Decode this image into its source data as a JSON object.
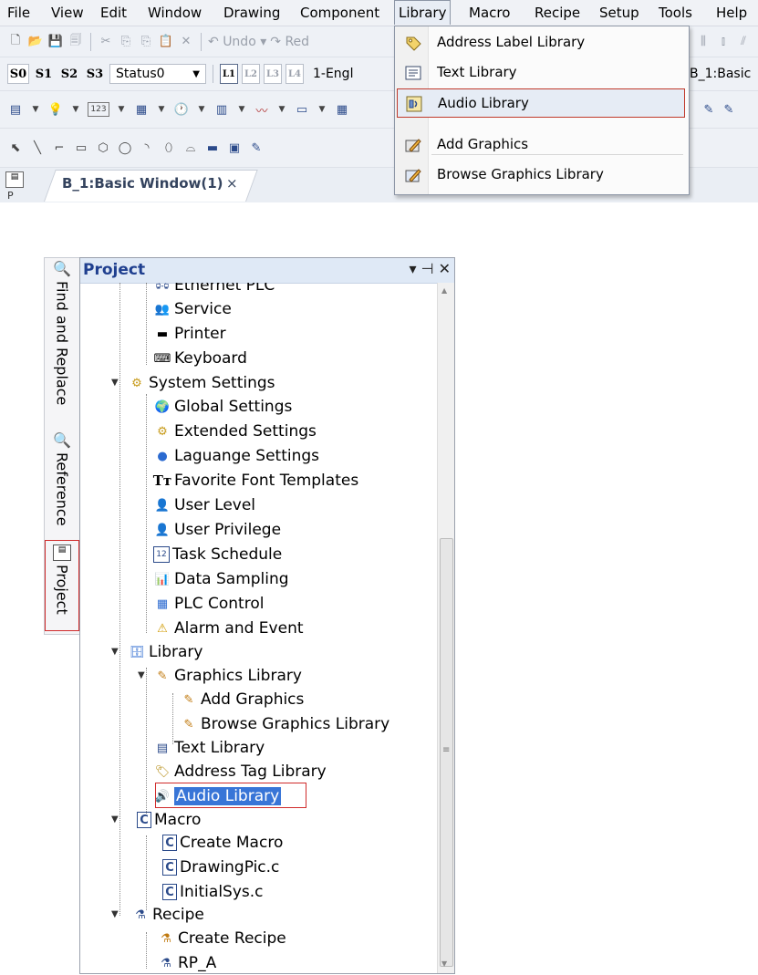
{
  "menubar": {
    "items": [
      "File",
      "View",
      "Edit",
      "Window",
      "Drawing",
      "Component",
      "Library",
      "Macro",
      "Recipe",
      "Setup",
      "Tools",
      "Help"
    ],
    "active": "Library"
  },
  "toolbar1": {
    "undo_label": "Undo",
    "redo_label": "Red"
  },
  "toolbar2": {
    "status_buttons": [
      "S0",
      "S1",
      "S2",
      "S3"
    ],
    "status_value": "Status0",
    "layer_buttons": [
      "L1",
      "L2",
      "L3",
      "L4"
    ],
    "language_value": "1-Engl",
    "window_value": "B_1:Basic"
  },
  "document_tab": {
    "label": "B_1:Basic Window(1)",
    "close": "×"
  },
  "library_menu": {
    "items": [
      {
        "label": "Address Label Library",
        "icon": "tag-icon"
      },
      {
        "label": "Text Library",
        "icon": "text-icon"
      },
      {
        "label": "Audio Library",
        "icon": "audio-icon",
        "highlighted": true
      },
      {
        "label": "Add Graphics",
        "icon": "add-graphics-icon"
      },
      {
        "label": "Browse Graphics Library",
        "icon": "browse-graphics-icon"
      }
    ]
  },
  "side_tabs": [
    "Find and Replace",
    "Reference",
    "Project"
  ],
  "panel": {
    "title": "Project",
    "controls": "▾ ⊣ ✕"
  },
  "tree": {
    "items": [
      {
        "label": "Ethernet PLC",
        "icon": "ethernet-plc-icon"
      },
      {
        "label": "Service",
        "icon": "service-icon"
      },
      {
        "label": "Printer",
        "icon": "printer-icon"
      },
      {
        "label": "Keyboard",
        "icon": "keyboard-icon"
      },
      {
        "label": "System Settings",
        "icon": "system-settings-icon"
      },
      {
        "label": "Global Settings",
        "icon": "globe-icon"
      },
      {
        "label": "Extended Settings",
        "icon": "extended-settings-icon"
      },
      {
        "label": "Laguange Settings",
        "icon": "language-icon"
      },
      {
        "label": "Favorite Font Templates",
        "icon": "font-icon"
      },
      {
        "label": "User Level",
        "icon": "user-level-icon"
      },
      {
        "label": "User Privilege",
        "icon": "user-privilege-icon"
      },
      {
        "label": "Task Schedule",
        "icon": "calendar-icon"
      },
      {
        "label": "Data Sampling",
        "icon": "chart-icon"
      },
      {
        "label": "PLC Control",
        "icon": "plc-control-icon"
      },
      {
        "label": "Alarm and Event",
        "icon": "alarm-icon"
      },
      {
        "label": "Library",
        "icon": "library-icon"
      },
      {
        "label": "Graphics Library",
        "icon": "graphics-library-icon"
      },
      {
        "label": "Add Graphics",
        "icon": "add-graphics-icon"
      },
      {
        "label": "Browse Graphics Library",
        "icon": "browse-graphics-icon"
      },
      {
        "label": "Text Library",
        "icon": "text-icon"
      },
      {
        "label": "Address Tag Library",
        "icon": "tag-icon"
      },
      {
        "label": "Audio Library",
        "icon": "audio-icon",
        "selected": true
      },
      {
        "label": "Macro",
        "icon": "macro-icon"
      },
      {
        "label": "Create Macro",
        "icon": "create-macro-icon"
      },
      {
        "label": "DrawingPic.c",
        "icon": "c-file-icon"
      },
      {
        "label": "InitialSys.c",
        "icon": "c-file-icon"
      },
      {
        "label": "Recipe",
        "icon": "recipe-icon"
      },
      {
        "label": "Create Recipe",
        "icon": "create-recipe-icon"
      },
      {
        "label": "RP_A",
        "icon": "recipe-icon"
      }
    ]
  },
  "colors": {
    "selection": "#3875d7",
    "annotation_red": "#d02b2b",
    "panel_title": "#1f3f8f"
  }
}
